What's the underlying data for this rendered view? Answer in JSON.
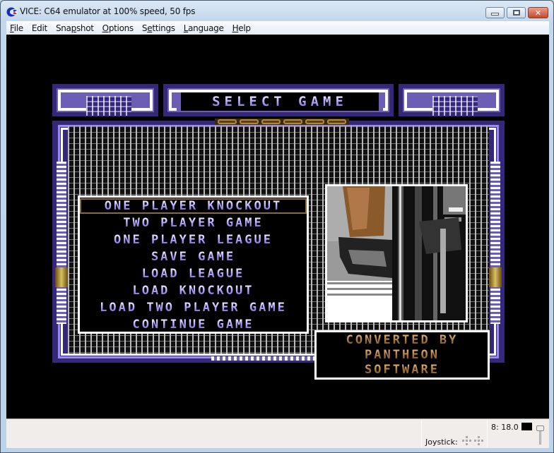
{
  "window": {
    "title": "VICE: C64 emulator at 100% speed, 50 fps",
    "app_icon": "commodore-logo-icon",
    "buttons": [
      "minimize",
      "maximize",
      "close"
    ]
  },
  "menubar": {
    "items": [
      {
        "label": "File",
        "mnemonic": "F",
        "rest": "ile"
      },
      {
        "label": "Edit",
        "mnemonic": "",
        "rest": "Edit"
      },
      {
        "label": "Snapshot",
        "pre": "Sna",
        "mnemonic": "p",
        "rest": "shot"
      },
      {
        "label": "Options",
        "mnemonic": "O",
        "rest": "ptions"
      },
      {
        "label": "Settings",
        "pre": "S",
        "mnemonic": "e",
        "rest": "ttings"
      },
      {
        "label": "Language",
        "mnemonic": "L",
        "rest": "anguage"
      },
      {
        "label": "Help",
        "mnemonic": "H",
        "rest": "elp"
      }
    ]
  },
  "game": {
    "title": "SELECT GAME",
    "menu_items": [
      "ONE PLAYER KNOCKOUT",
      "TWO PLAYER GAME",
      "ONE PLAYER LEAGUE",
      "SAVE GAME",
      "LOAD LEAGUE",
      "LOAD KNOCKOUT",
      "LOAD TWO PLAYER GAME",
      "CONTINUE GAME"
    ],
    "selected_index": 0,
    "credits": [
      "CONVERTED BY",
      "PANTHEON",
      "SOFTWARE"
    ],
    "colors": {
      "frame_dark": "#352879",
      "frame_mid": "#6c5eb5",
      "frame_light": "#9a8af0",
      "text_gold": "#a87838",
      "selection_border": "#8a6a3a"
    }
  },
  "statusbar": {
    "joystick_label": "Joystick:",
    "speed_readout": "8: 18.0",
    "drive_led_color": "#000000"
  }
}
